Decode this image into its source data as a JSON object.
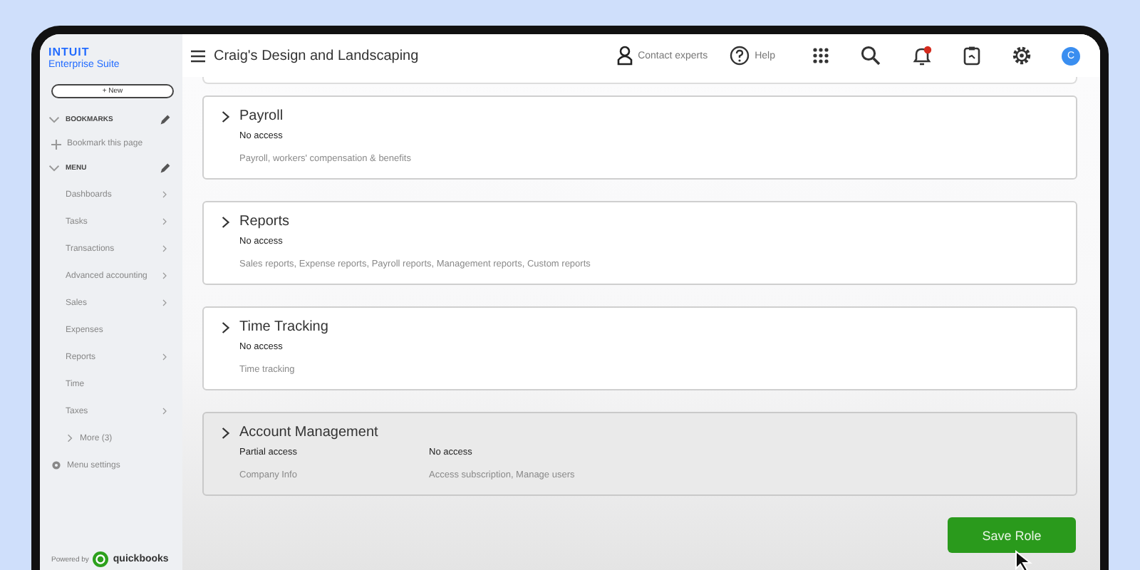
{
  "sidebar": {
    "brand": "INTUIT",
    "product": "Enterprise Suite",
    "new_button": "+ New",
    "sections": [
      {
        "title": "BOOKMARKS",
        "expanded": true,
        "items": [
          {
            "label": "Bookmark this page",
            "kind": "add",
            "has_submenu": false
          }
        ]
      },
      {
        "title": "MENU",
        "expanded": true,
        "items": [
          {
            "label": "Dashboards",
            "kind": "link",
            "has_submenu": true
          },
          {
            "label": "Tasks",
            "kind": "link",
            "has_submenu": true
          },
          {
            "label": "Transactions",
            "kind": "link",
            "has_submenu": true
          },
          {
            "label": "Advanced accounting",
            "kind": "link",
            "has_submenu": true
          },
          {
            "label": "Sales",
            "kind": "link",
            "has_submenu": true
          },
          {
            "label": "Expenses",
            "kind": "link",
            "has_submenu": false
          },
          {
            "label": "Reports",
            "kind": "link",
            "has_submenu": true
          },
          {
            "label": "Time",
            "kind": "link",
            "has_submenu": false
          },
          {
            "label": "Taxes",
            "kind": "link",
            "has_submenu": true
          },
          {
            "label": "More (3)",
            "kind": "more",
            "has_submenu": false
          }
        ]
      }
    ],
    "settings": "Menu settings",
    "powered_by": "Powered by",
    "powered_brand": "quickbooks"
  },
  "header": {
    "company": "Craig's Design and Landscaping",
    "contact": "Contact experts",
    "help": "Help",
    "avatar": "C",
    "notification": true
  },
  "permissions": [
    {
      "title": "Payroll",
      "expanded": false,
      "columns": [
        {
          "access": "No access",
          "description": "Payroll, workers' compensation & benefits"
        }
      ]
    },
    {
      "title": "Reports",
      "expanded": false,
      "columns": [
        {
          "access": "No access",
          "description": "Sales reports, Expense reports, Payroll reports, Management reports, Custom reports"
        }
      ]
    },
    {
      "title": "Time Tracking",
      "expanded": false,
      "columns": [
        {
          "access": "No access",
          "description": "Time tracking"
        }
      ]
    },
    {
      "title": "Account Management",
      "expanded": false,
      "columns": [
        {
          "access": "Partial access",
          "description": "Company Info"
        },
        {
          "access": "No access",
          "description": "Access subscription, Manage users"
        }
      ]
    }
  ],
  "save_button": "Save Role"
}
